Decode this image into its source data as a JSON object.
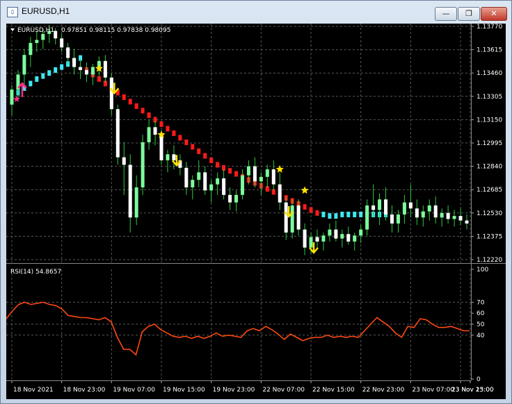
{
  "window": {
    "title": "EURUSD,H1",
    "minimize_glyph": "—",
    "maximize_glyph": "❐",
    "close_glyph": "✕",
    "icon": "chart-window-icon"
  },
  "colors": {
    "background": "#000000",
    "grid": "#5a5a5a",
    "text": "#ffffff",
    "bull": "#7CFC9C",
    "bear": "#ffffff",
    "wick": "#2ecc40",
    "trend_up": "#3ee8f0",
    "trend_down": "#ff1a1a",
    "signal_arrow": "#ffe000",
    "up_arrow": "#ff2a8a",
    "rsi_line": "#ff4a10"
  },
  "chart_data": [
    {
      "type": "candlestick",
      "title": "EURUSD,H1  0.97851 0.98115 0.97838 0.98095",
      "symbol_label": "EURUSD,H1",
      "ohlc_label": "0.97851 0.98115 0.97838 0.98095",
      "y_ticks": [
        "1.13770",
        "1.13615",
        "1.13460",
        "1.13305",
        "1.13150",
        "1.12995",
        "1.12840",
        "1.12685",
        "1.12530",
        "1.12375",
        "1.12220"
      ],
      "y_tick_values": [
        1.1377,
        1.13615,
        1.1346,
        1.13305,
        1.1315,
        1.12995,
        1.1284,
        1.12685,
        1.1253,
        1.12375,
        1.1222
      ],
      "ylim": [
        1.1222,
        1.1377
      ],
      "x_ticks": [
        "18 Nov 2021",
        "18 Nov 23:00",
        "19 Nov 07:00",
        "19 Nov 15:00",
        "19 Nov 23:00",
        "22 Nov 07:00",
        "22 Nov 15:00",
        "22 Nov 23:00",
        "23 Nov 07:00",
        "23 Nov 15:00",
        "23 Nov 23:00"
      ],
      "x_tick_index": [
        0,
        8,
        16,
        24,
        32,
        40,
        48,
        56,
        64,
        72,
        80
      ],
      "candles": [
        [
          1.1325,
          1.1338,
          1.1318,
          1.1335
        ],
        [
          1.1335,
          1.1348,
          1.1328,
          1.1345
        ],
        [
          1.1345,
          1.1362,
          1.1338,
          1.1358
        ],
        [
          1.1358,
          1.137,
          1.135,
          1.1366
        ],
        [
          1.1366,
          1.1374,
          1.136,
          1.1368
        ],
        [
          1.1368,
          1.1375,
          1.1362,
          1.1372
        ],
        [
          1.1372,
          1.1378,
          1.1366,
          1.1374
        ],
        [
          1.1374,
          1.1376,
          1.1365,
          1.1369
        ],
        [
          1.1369,
          1.1372,
          1.136,
          1.1363
        ],
        [
          1.1363,
          1.1366,
          1.1352,
          1.1356
        ],
        [
          1.1356,
          1.1362,
          1.1345,
          1.135
        ],
        [
          1.135,
          1.1355,
          1.1342,
          1.1348
        ],
        [
          1.1348,
          1.1353,
          1.134,
          1.1345
        ],
        [
          1.1345,
          1.1352,
          1.1338,
          1.135
        ],
        [
          1.135,
          1.1357,
          1.1344,
          1.1354
        ],
        [
          1.1354,
          1.1358,
          1.134,
          1.1343
        ],
        [
          1.1343,
          1.1346,
          1.1318,
          1.1322
        ],
        [
          1.1322,
          1.1325,
          1.1285,
          1.129
        ],
        [
          1.129,
          1.13,
          1.1265,
          1.1285
        ],
        [
          1.1285,
          1.1292,
          1.124,
          1.125
        ],
        [
          1.125,
          1.1278,
          1.1245,
          1.127
        ],
        [
          1.127,
          1.1305,
          1.1265,
          1.13
        ],
        [
          1.13,
          1.1315,
          1.1295,
          1.131
        ],
        [
          1.131,
          1.1314,
          1.1298,
          1.1305
        ],
        [
          1.1305,
          1.1308,
          1.1285,
          1.1288
        ],
        [
          1.1288,
          1.1295,
          1.128,
          1.1292
        ],
        [
          1.1292,
          1.1298,
          1.1282,
          1.1288
        ],
        [
          1.1288,
          1.1292,
          1.1278,
          1.1283
        ],
        [
          1.1283,
          1.1287,
          1.1265,
          1.127
        ],
        [
          1.127,
          1.1278,
          1.1262,
          1.1275
        ],
        [
          1.1275,
          1.1288,
          1.127,
          1.128
        ],
        [
          1.128,
          1.1284,
          1.1265,
          1.1268
        ],
        [
          1.1268,
          1.1275,
          1.126,
          1.1272
        ],
        [
          1.1272,
          1.128,
          1.1265,
          1.1276
        ],
        [
          1.1276,
          1.1282,
          1.1262,
          1.1265
        ],
        [
          1.1265,
          1.127,
          1.1255,
          1.126
        ],
        [
          1.126,
          1.1268,
          1.1254,
          1.1265
        ],
        [
          1.1265,
          1.1282,
          1.1262,
          1.1278
        ],
        [
          1.1278,
          1.1288,
          1.1272,
          1.1284
        ],
        [
          1.1284,
          1.129,
          1.127,
          1.1274
        ],
        [
          1.1274,
          1.128,
          1.1265,
          1.1277
        ],
        [
          1.1277,
          1.1285,
          1.127,
          1.1282
        ],
        [
          1.1282,
          1.1288,
          1.1268,
          1.1272
        ],
        [
          1.1272,
          1.128,
          1.1255,
          1.126
        ],
        [
          1.126,
          1.1264,
          1.1235,
          1.124
        ],
        [
          1.124,
          1.1262,
          1.1236,
          1.1258
        ],
        [
          1.1258,
          1.1262,
          1.1238,
          1.1242
        ],
        [
          1.1242,
          1.1246,
          1.1225,
          1.123
        ],
        [
          1.123,
          1.124,
          1.1226,
          1.1237
        ],
        [
          1.1237,
          1.1242,
          1.123,
          1.1234
        ],
        [
          1.1234,
          1.124,
          1.1228,
          1.1238
        ],
        [
          1.1238,
          1.1246,
          1.1234,
          1.1242
        ],
        [
          1.1242,
          1.1248,
          1.1234,
          1.1236
        ],
        [
          1.1236,
          1.1242,
          1.123,
          1.1239
        ],
        [
          1.1239,
          1.1244,
          1.1232,
          1.1234
        ],
        [
          1.1234,
          1.124,
          1.1228,
          1.1238
        ],
        [
          1.1238,
          1.1245,
          1.1233,
          1.1242
        ],
        [
          1.1242,
          1.1262,
          1.1238,
          1.1258
        ],
        [
          1.1258,
          1.1272,
          1.125,
          1.1255
        ],
        [
          1.1255,
          1.1266,
          1.1245,
          1.1262
        ],
        [
          1.1262,
          1.127,
          1.1248,
          1.1252
        ],
        [
          1.1252,
          1.1258,
          1.124,
          1.1246
        ],
        [
          1.1246,
          1.1255,
          1.124,
          1.1252
        ],
        [
          1.1252,
          1.1265,
          1.1246,
          1.126
        ],
        [
          1.126,
          1.1272,
          1.125,
          1.1256
        ],
        [
          1.1256,
          1.1262,
          1.1245,
          1.125
        ],
        [
          1.125,
          1.1258,
          1.1244,
          1.1254
        ],
        [
          1.1254,
          1.1262,
          1.1248,
          1.1258
        ],
        [
          1.1258,
          1.1264,
          1.1246,
          1.125
        ],
        [
          1.125,
          1.1256,
          1.1244,
          1.1253
        ],
        [
          1.1253,
          1.1258,
          1.1246,
          1.1249
        ],
        [
          1.1249,
          1.1255,
          1.1244,
          1.1251
        ],
        [
          1.1251,
          1.1256,
          1.1245,
          1.1248
        ],
        [
          1.1248,
          1.1252,
          1.1242,
          1.1246
        ]
      ],
      "trend_line": [
        1.133,
        1.1333,
        1.1336,
        1.1339,
        1.1342,
        1.1344,
        1.1346,
        1.1348,
        1.135,
        1.1352,
        1.1354,
        1.1356,
        1.1348,
        1.1345,
        1.1342,
        1.1339,
        1.1336,
        1.1333,
        1.133,
        1.1327,
        1.1324,
        1.1321,
        1.1318,
        1.1315,
        1.1312,
        1.1309,
        1.1306,
        1.1303,
        1.13,
        1.1297,
        1.1294,
        1.1291,
        1.1288,
        1.1285,
        1.1283,
        1.1281,
        1.1279,
        1.1277,
        1.1275,
        1.1273,
        1.1271,
        1.1269,
        1.1267,
        1.1265,
        1.1263,
        1.1261,
        1.1259,
        1.1257,
        1.1255,
        1.1253,
        1.1252,
        1.1251,
        1.1251,
        1.1252,
        1.1252,
        1.1252,
        1.1252,
        1.1252,
        1.1252,
        1.1252,
        1.1252
      ],
      "trend_direction": [
        "up",
        "up",
        "up",
        "up",
        "up",
        "up",
        "up",
        "up",
        "up",
        "up",
        "up",
        "up",
        "down",
        "down",
        "down",
        "down",
        "down",
        "down",
        "down",
        "down",
        "down",
        "down",
        "down",
        "down",
        "down",
        "down",
        "down",
        "down",
        "down",
        "down",
        "down",
        "down",
        "down",
        "down",
        "down",
        "down",
        "down",
        "down",
        "down",
        "down",
        "down",
        "down",
        "down",
        "down",
        "down",
        "down",
        "down",
        "down",
        "down",
        "down",
        "up",
        "up",
        "up",
        "up",
        "up",
        "up",
        "up",
        "up",
        "up",
        "up",
        "up"
      ],
      "signal_arrows": [
        {
          "index": 16,
          "direction": "down"
        },
        {
          "index": 26,
          "direction": "down"
        },
        {
          "index": 44,
          "direction": "down"
        },
        {
          "index": 48,
          "direction": "down"
        }
      ],
      "signal_stars": [
        {
          "index": 14,
          "price": 1.1349
        },
        {
          "index": 24,
          "price": 1.1305
        },
        {
          "index": 43,
          "price": 1.1282
        },
        {
          "index": 47,
          "price": 1.1268
        }
      ],
      "up_arrows": [
        {
          "index": 1,
          "price": 1.133
        }
      ]
    },
    {
      "type": "line",
      "title": "RSI(14) 54.8657",
      "label": "RSI(14) 54.8657",
      "y_ticks": [
        "100",
        "70",
        "60",
        "50",
        "40",
        "0"
      ],
      "y_tick_values": [
        100,
        70,
        60,
        50,
        40,
        0
      ],
      "ylim": [
        0,
        100
      ],
      "levels": [
        70,
        50,
        40
      ],
      "values": [
        55,
        62,
        68,
        70,
        68,
        69,
        70,
        68,
        67,
        64,
        58,
        57,
        56,
        56,
        55,
        54,
        56,
        52,
        38,
        27,
        27,
        22,
        43,
        48,
        50,
        45,
        42,
        39,
        38,
        39,
        37,
        39,
        37,
        39,
        42,
        39,
        40,
        39,
        38,
        44,
        46,
        44,
        48,
        45,
        41,
        36,
        41,
        38,
        35,
        37,
        38,
        38,
        40,
        38,
        39,
        38,
        39,
        38,
        44,
        50,
        56,
        52,
        48,
        42,
        38,
        48,
        47,
        55,
        54,
        50,
        47,
        47,
        48,
        46,
        44,
        44
      ]
    }
  ]
}
